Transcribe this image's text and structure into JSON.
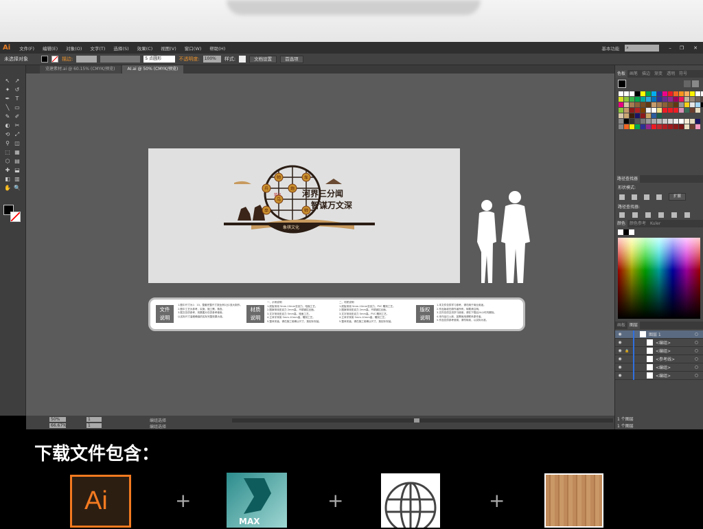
{
  "app": {
    "logo": "Ai",
    "menu": [
      "文件(F)",
      "编辑(E)",
      "对象(O)",
      "文字(T)",
      "选择(S)",
      "效果(C)",
      "视图(V)",
      "窗口(W)",
      "帮助(H)"
    ],
    "workspace": "基本功能",
    "search_placeholder": ""
  },
  "control": {
    "selection": "未选择对象",
    "stroke_label": "描边:",
    "brush": "5 点圆形",
    "opacity_label": "不透明度:",
    "opacity": "100%",
    "style_label": "样式:",
    "doc_setup": "文档设置",
    "prefs": "首选项"
  },
  "tabs": [
    {
      "label": "览建素材.ai @ 60.15% (CMYK/预览)"
    },
    {
      "label": "AI.ai @ 50% (CMYK/预览)"
    }
  ],
  "artwork": {
    "title1": "河界三分闻",
    "title2": "智谋万文深",
    "badge": "象棋文化",
    "pieces": [
      "帅",
      "车",
      "兵",
      "炮",
      "马",
      "卒"
    ],
    "river": "楚河"
  },
  "strip": {
    "blocks": [
      {
        "l1": "文件",
        "l2": "说明"
      },
      {
        "l1": "材质",
        "l2": "说明"
      },
      {
        "l1": "版权",
        "l2": "说明"
      }
    ],
    "col1": [
      "1.图中尺寸为1：10，整套完整尺寸按比例1比1放大制作。",
      "2.图中工艺为参考，实施，施工需，核查。",
      "3.图文仅供参考，效果图片仅供参考使用。",
      "  以实际尺寸量程确保的实际完整效果为准。"
    ],
    "col2": [
      "一、示例说明",
      "1.底板采用 5mm-10mm亚克力，哑面工艺。",
      "2.图案采用亚克力 2mm高，不锈钢拉丝面。",
      "3.文字采用亚克力 5mm高，哑面工艺。",
      "4.立体字采用 5mm-10mm高，雕刻工艺。",
      "5.整体安装，请在施工前确认尺寸，按实际安装。"
    ],
    "col3": [
      "二、材质说明",
      "1.底板采用 5mm-10mm亚克力，PVC 雕刻工艺。",
      "2.图案采用亚克力 2mm高，不锈钢拉丝面。",
      "3.文字采用亚克力 5mm高，PVC 雕刻工艺。",
      "4.立体字采用 5mm-10mm高，雕刻工艺。",
      "5.整体安装，请在施工前确认尺寸，按实际安装。"
    ],
    "col4": [
      "1.本文件仅供学习参考，请勿用于商业用途。",
      "2.作品版权归原作者所有，转载请注明。",
      "3.文件仅供交流学习使用，请在下载后24小时内删除。",
      "4.本作品已入库，如需商用请联系原作者。",
      "5.作品仅供参考使用，请勿转卖，以实际为准。"
    ]
  },
  "panels": {
    "swatch_tabs": [
      "色板",
      "画笔",
      "描边",
      "渐变",
      "透明",
      "符号"
    ],
    "swatches": [
      "#ffffff",
      "#ffffff",
      "#ffffff",
      "#000000",
      "#ffff00",
      "#00a651",
      "#00aeef",
      "#2e3192",
      "#ec008c",
      "#ed1c24",
      "#f26522",
      "#f7941d",
      "#fbaf5d",
      "#fff200",
      "#ffffff",
      "#ffffff",
      "#d7df23",
      "#8dc63f",
      "#39b54a",
      "#00a651",
      "#00a99d",
      "#29abe2",
      "#0072bc",
      "#2e3192",
      "#662d91",
      "#92278f",
      "#9e005d",
      "#ed145b",
      "#c2b59b",
      "#998675",
      "#736357",
      "#534741",
      "#e6007e",
      "#d8c3a5",
      "#a67c52",
      "#8c6239",
      "#754c24",
      "#603913",
      "#c69c6d",
      "#a67c52",
      "#8c6239",
      "#754c24",
      "#603913",
      "#999999",
      "#f7d117",
      "#e5e5e5",
      "#a3d5f5",
      "#000000",
      "#8dc63f",
      "#c49a6c",
      "#8b1a1a",
      "#b22222",
      "#7b3f00",
      "#eeeeee",
      "#ffffff",
      "#eedd88",
      "#ed1c24",
      "#ed1c24",
      "#ed1c24",
      "#d891b6",
      "#3a6b57",
      "#6b3e2e",
      "#e8dcc0",
      "#474747",
      "#d9c8a9",
      "#caa772",
      "#3c1f0a",
      "#1b1464",
      "#8b1a1a",
      "#c8a464",
      "#2a5c9e",
      "#1b5e4a",
      "#474747",
      "#474747",
      "#474747",
      "#474747",
      "#474747",
      "#474747",
      "#474747",
      "#474747",
      "#888888",
      "#000000",
      "#333333",
      "#555555",
      "#777777",
      "#999999",
      "#aaaaaa",
      "#bbbbbb",
      "#cccccc",
      "#dddddd",
      "#eeeeee",
      "#ffffff",
      "#f5ead5",
      "#e8dcc0",
      "#1b1464",
      "#474747",
      "#888888",
      "#f26522",
      "#fff200",
      "#00a651",
      "#2e3192",
      "#92278f",
      "#ed1c24",
      "#c1272d",
      "#b11f24",
      "#9e1b20",
      "#8b1a1a",
      "#7a1616",
      "#e8dcc0",
      "#6b3e2e",
      "#f49ac1",
      "#474747"
    ],
    "pathfinder": {
      "tab": "路径查找器",
      "shape_modes": "形状模式:",
      "expand": "扩展",
      "pathfinders": "路径查找器:"
    },
    "color_tabs": [
      "颜色",
      "颜色参考",
      "Kuler"
    ],
    "layer_tabs": [
      "画板",
      "图层"
    ],
    "layers": [
      {
        "name": "图层 1",
        "top": true
      },
      {
        "name": "<编组>"
      },
      {
        "name": "<编组>",
        "locked": true
      },
      {
        "name": "<参考线>"
      },
      {
        "name": "<编组>"
      },
      {
        "name": "<编组>"
      }
    ],
    "layer_count": "1 个图层"
  },
  "status": {
    "zoom1": "50%",
    "zoom2": "66.67%",
    "page": "1",
    "label": "编组选择"
  },
  "download": {
    "title": "下载文件包含：",
    "items": [
      "Ai",
      "MAX"
    ],
    "plus": "+"
  }
}
